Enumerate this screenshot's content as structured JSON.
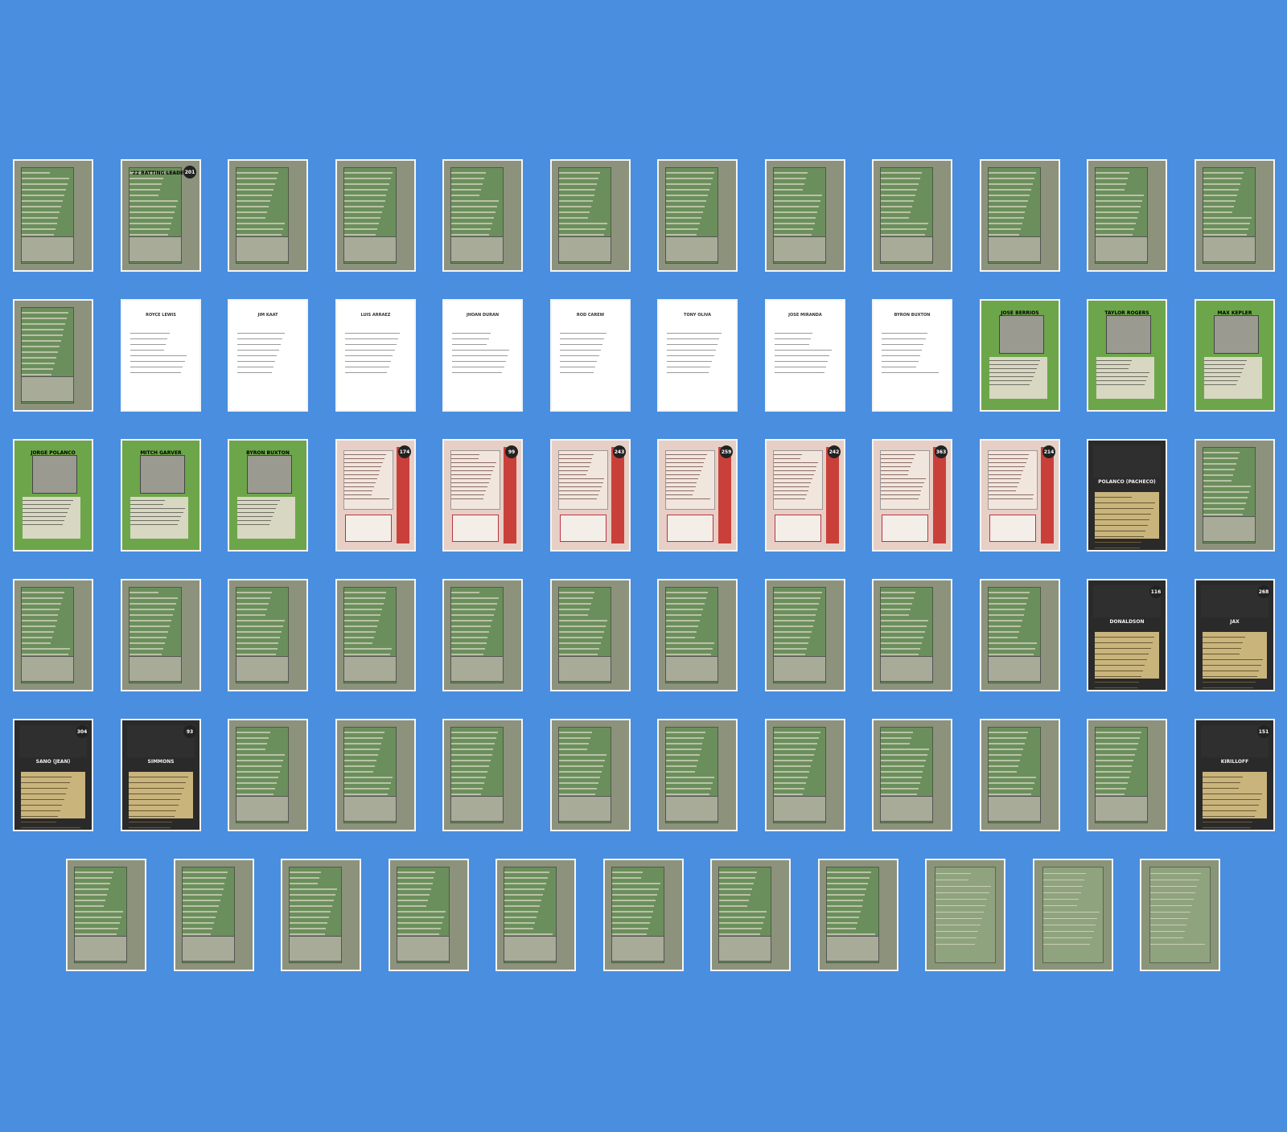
{
  "colors": {
    "background": "#4a8ee0",
    "grey": "#8c927c",
    "white": "#ffffff",
    "green": "#6da64a",
    "red": "#c9403b",
    "dark": "#2a2a2a",
    "olive": "#8a9478"
  },
  "cards": [
    {
      "type": "grey",
      "num": "",
      "title": ""
    },
    {
      "type": "grey",
      "num": "201",
      "title": "'22 BATTING LEADERS"
    },
    {
      "type": "grey",
      "num": "",
      "title": ""
    },
    {
      "type": "grey",
      "num": "",
      "title": ""
    },
    {
      "type": "grey",
      "num": "",
      "title": ""
    },
    {
      "type": "grey",
      "num": "",
      "title": ""
    },
    {
      "type": "grey",
      "num": "",
      "title": ""
    },
    {
      "type": "grey",
      "num": "",
      "title": ""
    },
    {
      "type": "grey",
      "num": "",
      "title": ""
    },
    {
      "type": "grey",
      "num": "",
      "title": ""
    },
    {
      "type": "grey",
      "num": "",
      "title": ""
    },
    {
      "type": "grey",
      "num": "",
      "title": ""
    },
    {
      "type": "grey",
      "num": "",
      "title": ""
    },
    {
      "type": "white",
      "num": "",
      "title": "ROYCE LEWIS"
    },
    {
      "type": "white",
      "num": "",
      "title": "JIM KAAT"
    },
    {
      "type": "white",
      "num": "",
      "title": "LUIS ARRAEZ"
    },
    {
      "type": "white",
      "num": "",
      "title": "JHOAN DURAN"
    },
    {
      "type": "white",
      "num": "",
      "title": "ROD CAREW"
    },
    {
      "type": "white",
      "num": "",
      "title": "TONY OLIVA"
    },
    {
      "type": "white",
      "num": "",
      "title": "JOSE MIRANDA"
    },
    {
      "type": "white",
      "num": "",
      "title": "BYRON BUXTON"
    },
    {
      "type": "green",
      "num": "",
      "title": "JOSE BERRIOS"
    },
    {
      "type": "green",
      "num": "",
      "title": "TAYLOR ROGERS"
    },
    {
      "type": "green",
      "num": "",
      "title": "MAX KEPLER"
    },
    {
      "type": "green",
      "num": "",
      "title": "JORGE POLANCO"
    },
    {
      "type": "green",
      "num": "",
      "title": "MITCH GARVER"
    },
    {
      "type": "green",
      "num": "",
      "title": "BYRON BUXTON"
    },
    {
      "type": "red",
      "num": "174",
      "title": ""
    },
    {
      "type": "red",
      "num": "99",
      "title": ""
    },
    {
      "type": "red",
      "num": "243",
      "title": ""
    },
    {
      "type": "red",
      "num": "259",
      "title": ""
    },
    {
      "type": "red",
      "num": "242",
      "title": ""
    },
    {
      "type": "red",
      "num": "363",
      "title": ""
    },
    {
      "type": "red",
      "num": "214",
      "title": ""
    },
    {
      "type": "dark",
      "num": "",
      "title": "POLANCO (PACHECO)"
    },
    {
      "type": "grey",
      "num": "",
      "title": ""
    },
    {
      "type": "grey",
      "num": "",
      "title": ""
    },
    {
      "type": "grey",
      "num": "",
      "title": ""
    },
    {
      "type": "grey",
      "num": "",
      "title": ""
    },
    {
      "type": "grey",
      "num": "",
      "title": ""
    },
    {
      "type": "grey",
      "num": "",
      "title": ""
    },
    {
      "type": "grey",
      "num": "",
      "title": ""
    },
    {
      "type": "grey",
      "num": "",
      "title": ""
    },
    {
      "type": "grey",
      "num": "",
      "title": ""
    },
    {
      "type": "grey",
      "num": "",
      "title": ""
    },
    {
      "type": "grey",
      "num": "",
      "title": ""
    },
    {
      "type": "dark",
      "num": "116",
      "title": "DONALDSON"
    },
    {
      "type": "dark",
      "num": "268",
      "title": "JAX"
    },
    {
      "type": "dark",
      "num": "304",
      "title": "SANO (JEAN)"
    },
    {
      "type": "dark",
      "num": "93",
      "title": "SIMMONS"
    },
    {
      "type": "grey",
      "num": "",
      "title": ""
    },
    {
      "type": "grey",
      "num": "",
      "title": ""
    },
    {
      "type": "grey",
      "num": "",
      "title": ""
    },
    {
      "type": "grey",
      "num": "",
      "title": ""
    },
    {
      "type": "grey",
      "num": "",
      "title": ""
    },
    {
      "type": "grey",
      "num": "",
      "title": ""
    },
    {
      "type": "grey",
      "num": "",
      "title": ""
    },
    {
      "type": "grey",
      "num": "",
      "title": ""
    },
    {
      "type": "grey",
      "num": "",
      "title": ""
    },
    {
      "type": "dark",
      "num": "151",
      "title": "KIRILLOFF"
    },
    {
      "type": "grey",
      "num": "",
      "title": ""
    },
    {
      "type": "grey",
      "num": "",
      "title": ""
    },
    {
      "type": "grey",
      "num": "",
      "title": ""
    },
    {
      "type": "grey",
      "num": "",
      "title": ""
    },
    {
      "type": "grey",
      "num": "",
      "title": ""
    },
    {
      "type": "grey",
      "num": "",
      "title": ""
    },
    {
      "type": "grey",
      "num": "",
      "title": ""
    },
    {
      "type": "grey",
      "num": "",
      "title": ""
    },
    {
      "type": "olive",
      "num": "",
      "title": ""
    },
    {
      "type": "olive",
      "num": "",
      "title": ""
    },
    {
      "type": "olive",
      "num": "",
      "title": ""
    }
  ]
}
